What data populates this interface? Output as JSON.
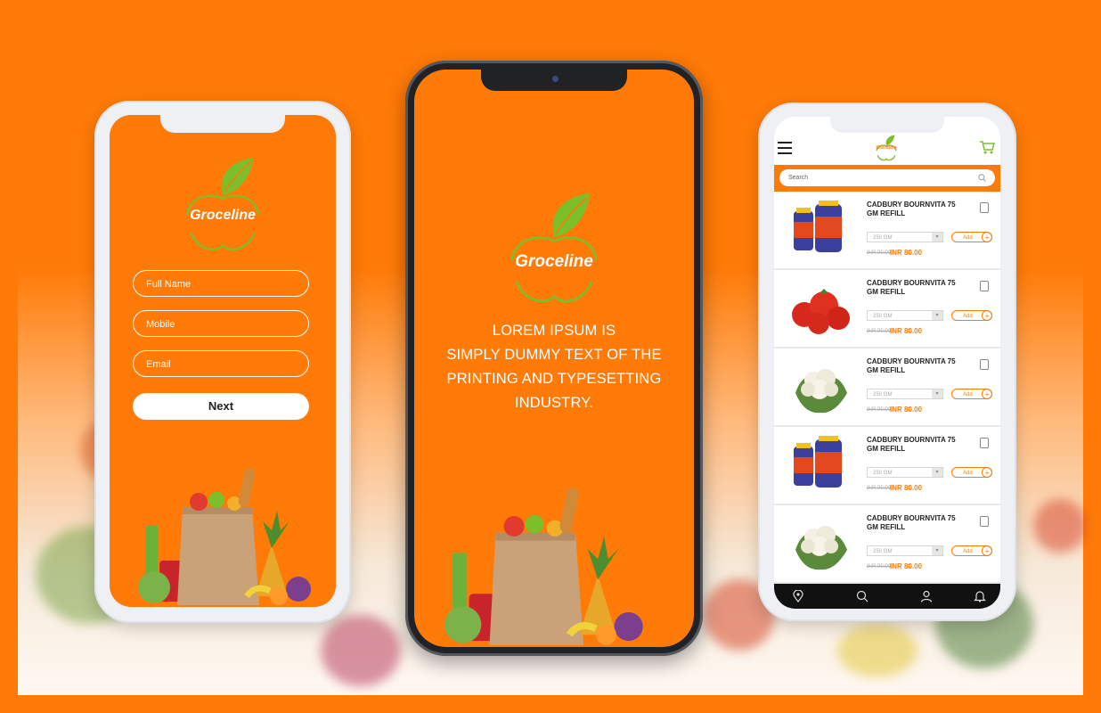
{
  "colors": {
    "brand": "#ff7a07",
    "leaf": "#7bc02b",
    "white": "#ffffff",
    "nav": "#111111"
  },
  "brand": {
    "logo_text": "Groceline"
  },
  "signup": {
    "fields": [
      {
        "placeholder": "Full Name"
      },
      {
        "placeholder": "Mobile"
      },
      {
        "placeholder": "Email"
      }
    ],
    "next_label": "Next"
  },
  "splash": {
    "tagline_lines": [
      "LOREM IPSUM IS",
      "SIMPLY DUMMY TEXT OF THE",
      "PRINTING AND TYPESETTING INDUSTRY."
    ]
  },
  "shop": {
    "header_logo": "Groceline",
    "search_placeholder": "Search",
    "products": [
      {
        "name": "CADBURY BOURNVITA  75 GM REFILL",
        "weight": "250 GM",
        "add_label": "Add",
        "old_price": "INR 90.00",
        "price": "INR 80.00",
        "image": "bournvita-jars"
      },
      {
        "name": "CADBURY BOURNVITA  75 GM REFILL",
        "weight": "250 GM",
        "add_label": "Add",
        "old_price": "INR 90.00",
        "price": "INR 80.00",
        "image": "tomatoes"
      },
      {
        "name": "CADBURY BOURNVITA  75 GM REFILL",
        "weight": "250 GM",
        "add_label": "Add",
        "old_price": "INR 90.00",
        "price": "INR 80.00",
        "image": "cauliflower"
      },
      {
        "name": "CADBURY BOURNVITA  75 GM REFILL",
        "weight": "250 GM",
        "add_label": "Add",
        "old_price": "INR 90.00",
        "price": "INR 80.00",
        "image": "bournvita-jars"
      },
      {
        "name": "CADBURY BOURNVITA  75 GM REFILL",
        "weight": "250 GM",
        "add_label": "Add",
        "old_price": "INR 90.00",
        "price": "INR 80.00",
        "image": "cauliflower"
      }
    ],
    "nav_icons": [
      "location-pin-icon",
      "search-icon",
      "user-icon",
      "bell-icon"
    ]
  }
}
